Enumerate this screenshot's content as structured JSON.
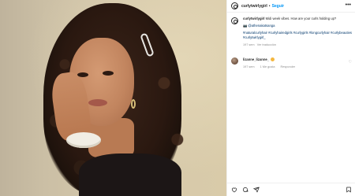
{
  "post": {
    "username": "curlytwirlygirl",
    "separator": "•",
    "follow_label": "Seguir",
    "more_label": "•••"
  },
  "caption": {
    "username": "curlytwirlygirl",
    "text": " Midi week vibes. How are your curls holding up?",
    "camera_emoji": "📷",
    "mention": "@athenakatsanga",
    "hashtags": "#naturalcurlyhair #curlyhairedgirls #curlygirls #longcurlyhair #curlybeauties #curlytwirlygirl_",
    "time": "197 sem",
    "translate_label": "Ver traducción"
  },
  "comment": {
    "username": "lizanne_lizanne_",
    "time": "197 sem",
    "likes_label": "1 Me gusta",
    "reply_label": "Responder",
    "heart": "♡"
  },
  "icons": {
    "like": "heart-icon",
    "comment": "comment-icon",
    "share": "share-icon",
    "save": "bookmark-icon",
    "more": "more-icon"
  },
  "colors": {
    "link": "#0095f6",
    "hashtag": "#00376b",
    "muted": "#8e8e8e"
  }
}
